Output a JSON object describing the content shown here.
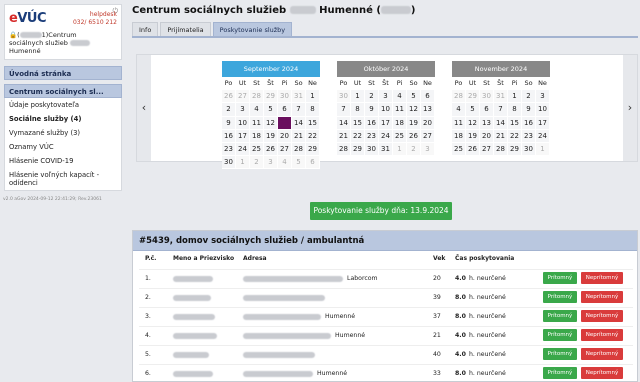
{
  "sidebar": {
    "logo": "VÚC",
    "logo_e": "e",
    "helpdesk": "helpdesk",
    "phone": "032/ 6510 212",
    "logout_icon": "power-icon",
    "user_line1": "1)Centrum",
    "user_line2": "sociálnych služieb",
    "user_line3": "Humenné",
    "menu_main": "Úvodná stránka",
    "menu_active": "Centrum sociálnych sl...",
    "items": [
      {
        "label": "Údaje poskytovateľa",
        "bold": false
      },
      {
        "label": "Sociálne služby (4)",
        "bold": true
      },
      {
        "label": "Vymazané služby (3)",
        "bold": false
      },
      {
        "label": "Oznamy VÚC",
        "bold": false
      },
      {
        "label": "Hlásenie COVID-19",
        "bold": false
      },
      {
        "label": "Hlásenie voľných kapacít - odídenci",
        "bold": false
      }
    ],
    "version": "v2.0 aGov 2024-09-12 22:41:29; Rev.23061"
  },
  "main": {
    "title_part1": "Centrum sociálnych služieb",
    "title_part2": "Humenné (",
    "title_part3": ")",
    "tabs": [
      {
        "label": "Info",
        "active": false
      },
      {
        "label": "Prijímatelia",
        "active": false
      },
      {
        "label": "Poskytovanie služby",
        "active": true
      }
    ]
  },
  "calendars": [
    {
      "title": "September 2024",
      "current": true,
      "headers": [
        "Po",
        "Ut",
        "St",
        "Št",
        "Pi",
        "So",
        "Ne"
      ],
      "cells": [
        {
          "d": "26",
          "m": true
        },
        {
          "d": "27",
          "m": true
        },
        {
          "d": "28",
          "m": true
        },
        {
          "d": "29",
          "m": true
        },
        {
          "d": "30",
          "m": true
        },
        {
          "d": "31",
          "m": true
        },
        {
          "d": "1"
        },
        {
          "d": "2"
        },
        {
          "d": "3"
        },
        {
          "d": "4"
        },
        {
          "d": "5"
        },
        {
          "d": "6"
        },
        {
          "d": "7"
        },
        {
          "d": "8"
        },
        {
          "d": "9"
        },
        {
          "d": "10"
        },
        {
          "d": "11"
        },
        {
          "d": "12"
        },
        {
          "d": "13",
          "sel": true
        },
        {
          "d": "14"
        },
        {
          "d": "15"
        },
        {
          "d": "16"
        },
        {
          "d": "17"
        },
        {
          "d": "18"
        },
        {
          "d": "19"
        },
        {
          "d": "20"
        },
        {
          "d": "21"
        },
        {
          "d": "22"
        },
        {
          "d": "23"
        },
        {
          "d": "24"
        },
        {
          "d": "25"
        },
        {
          "d": "26"
        },
        {
          "d": "27"
        },
        {
          "d": "28"
        },
        {
          "d": "29"
        },
        {
          "d": "30"
        },
        {
          "d": "1",
          "m": true
        },
        {
          "d": "2",
          "m": true
        },
        {
          "d": "3",
          "m": true
        },
        {
          "d": "4",
          "m": true
        },
        {
          "d": "5",
          "m": true
        },
        {
          "d": "6",
          "m": true
        }
      ]
    },
    {
      "title": "Október 2024",
      "current": false,
      "headers": [
        "Po",
        "Ut",
        "St",
        "Št",
        "Pi",
        "So",
        "Ne"
      ],
      "cells": [
        {
          "d": "30",
          "m": true
        },
        {
          "d": "1"
        },
        {
          "d": "2"
        },
        {
          "d": "3"
        },
        {
          "d": "4"
        },
        {
          "d": "5"
        },
        {
          "d": "6"
        },
        {
          "d": "7"
        },
        {
          "d": "8"
        },
        {
          "d": "9"
        },
        {
          "d": "10"
        },
        {
          "d": "11"
        },
        {
          "d": "12"
        },
        {
          "d": "13"
        },
        {
          "d": "14"
        },
        {
          "d": "15"
        },
        {
          "d": "16"
        },
        {
          "d": "17"
        },
        {
          "d": "18"
        },
        {
          "d": "19"
        },
        {
          "d": "20"
        },
        {
          "d": "21"
        },
        {
          "d": "22"
        },
        {
          "d": "23"
        },
        {
          "d": "24"
        },
        {
          "d": "25"
        },
        {
          "d": "26"
        },
        {
          "d": "27"
        },
        {
          "d": "28"
        },
        {
          "d": "29"
        },
        {
          "d": "30"
        },
        {
          "d": "31"
        },
        {
          "d": "1",
          "m": true
        },
        {
          "d": "2",
          "m": true
        },
        {
          "d": "3",
          "m": true
        }
      ]
    },
    {
      "title": "November 2024",
      "current": false,
      "headers": [
        "Po",
        "Ut",
        "St",
        "Št",
        "Pi",
        "So",
        "Ne"
      ],
      "cells": [
        {
          "d": "28",
          "m": true
        },
        {
          "d": "29",
          "m": true
        },
        {
          "d": "30",
          "m": true
        },
        {
          "d": "31",
          "m": true
        },
        {
          "d": "1"
        },
        {
          "d": "2"
        },
        {
          "d": "3"
        },
        {
          "d": "4"
        },
        {
          "d": "5"
        },
        {
          "d": "6"
        },
        {
          "d": "7"
        },
        {
          "d": "8"
        },
        {
          "d": "9"
        },
        {
          "d": "10"
        },
        {
          "d": "11"
        },
        {
          "d": "12"
        },
        {
          "d": "13"
        },
        {
          "d": "14"
        },
        {
          "d": "15"
        },
        {
          "d": "16"
        },
        {
          "d": "17"
        },
        {
          "d": "18"
        },
        {
          "d": "19"
        },
        {
          "d": "20"
        },
        {
          "d": "21"
        },
        {
          "d": "22"
        },
        {
          "d": "23"
        },
        {
          "d": "24"
        },
        {
          "d": "25"
        },
        {
          "d": "26"
        },
        {
          "d": "27"
        },
        {
          "d": "28"
        },
        {
          "d": "29"
        },
        {
          "d": "30"
        },
        {
          "d": "1",
          "m": true
        }
      ]
    }
  ],
  "date_button": "Poskytovanie služby dňa: 13.9.2024",
  "service": {
    "header": "#5439, domov sociálnych služieb / ambulantná",
    "columns": {
      "pc": "P.č.",
      "name": "Meno a Priezvisko",
      "address": "Adresa",
      "vek": "Vek",
      "cas": "Čas poskytovania"
    },
    "present_label": "Prítomný",
    "absent_label": "Neprítomný",
    "rows": [
      {
        "pc": "1.",
        "addr_suffix": "Laborcom",
        "vek": "20",
        "hours": "4.0",
        "unit": "h. neurčené"
      },
      {
        "pc": "2.",
        "addr_suffix": "",
        "vek": "39",
        "hours": "8.0",
        "unit": "h. neurčené"
      },
      {
        "pc": "3.",
        "addr_suffix": "Humenné",
        "vek": "37",
        "hours": "8.0",
        "unit": "h. neurčené"
      },
      {
        "pc": "4.",
        "addr_suffix": "Humenné",
        "vek": "21",
        "hours": "4.0",
        "unit": "h. neurčené"
      },
      {
        "pc": "5.",
        "addr_suffix": "",
        "vek": "40",
        "hours": "4.0",
        "unit": "h. neurčené"
      },
      {
        "pc": "6.",
        "addr_suffix": "Humenné",
        "vek": "33",
        "hours": "8.0",
        "unit": "h. neurčené"
      }
    ]
  },
  "colors": {
    "accent_blue": "#3da6dc",
    "header_blue": "#b9c7df",
    "green": "#3aa84a",
    "red": "#d93b3b",
    "selected_day": "#6a0f5e"
  }
}
